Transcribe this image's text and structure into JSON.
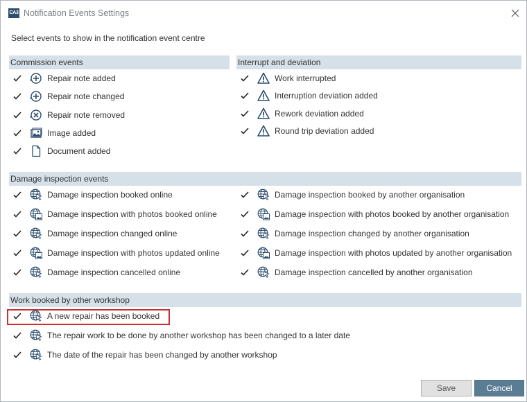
{
  "window": {
    "title": "Notification Events Settings",
    "logo_text": "CA3"
  },
  "intro": "Select events to show in the notification event centre",
  "sections": {
    "commission": {
      "title": "Commission events",
      "items": [
        {
          "label": "Repair note added",
          "icon": "note-add-icon"
        },
        {
          "label": "Repair note changed",
          "icon": "note-change-icon"
        },
        {
          "label": "Repair note removed",
          "icon": "note-remove-icon"
        },
        {
          "label": "Image added",
          "icon": "image-icon"
        },
        {
          "label": "Document added",
          "icon": "document-icon"
        }
      ]
    },
    "interrupt": {
      "title": "Interrupt and deviation",
      "items": [
        {
          "label": "Work interrupted",
          "icon": "warning-icon"
        },
        {
          "label": "Interruption deviation added",
          "icon": "warning-icon"
        },
        {
          "label": "Rework deviation added",
          "icon": "warning-icon"
        },
        {
          "label": "Round trip deviation added",
          "icon": "warning-icon"
        }
      ]
    },
    "damage": {
      "title": "Damage inspection events",
      "left": [
        {
          "label": "Damage inspection booked online",
          "icon": "globe-cursor-icon"
        },
        {
          "label": "Damage inspection with photos booked online",
          "icon": "globe-photo-icon"
        },
        {
          "label": "Damage inspection changed online",
          "icon": "globe-cursor-icon"
        },
        {
          "label": "Damage inspection with photos updated online",
          "icon": "globe-photo-icon"
        },
        {
          "label": "Damage inspection cancelled online",
          "icon": "globe-cursor-icon"
        }
      ],
      "right": [
        {
          "label": "Damage inspection booked by another organisation",
          "icon": "globe-cursor-icon"
        },
        {
          "label": "Damage inspection with photos booked by another organisation",
          "icon": "globe-photo-icon"
        },
        {
          "label": "Damage inspection changed by another organisation",
          "icon": "globe-cursor-icon"
        },
        {
          "label": "Damage inspection with photos updated by another organisation",
          "icon": "globe-photo-icon"
        },
        {
          "label": "Damage inspection cancelled by another organisation",
          "icon": "globe-cursor-icon"
        }
      ]
    },
    "workshop": {
      "title": "Work booked by other workshop",
      "items": [
        {
          "label": "A new repair has been booked",
          "icon": "globe-cursor-icon"
        },
        {
          "label": "The repair work to be done by another workshop has been changed to a later date",
          "icon": "globe-cursor-icon"
        },
        {
          "label": "The date of the repair has been changed by another workshop",
          "icon": "globe-cursor-icon"
        }
      ]
    }
  },
  "buttons": {
    "save": "Save",
    "cancel": "Cancel"
  },
  "colors": {
    "section_bar": "#d5e0e8",
    "icon": "#2c4e6e",
    "highlight": "#cc2f34",
    "cancel_bg": "#5b7d94"
  }
}
